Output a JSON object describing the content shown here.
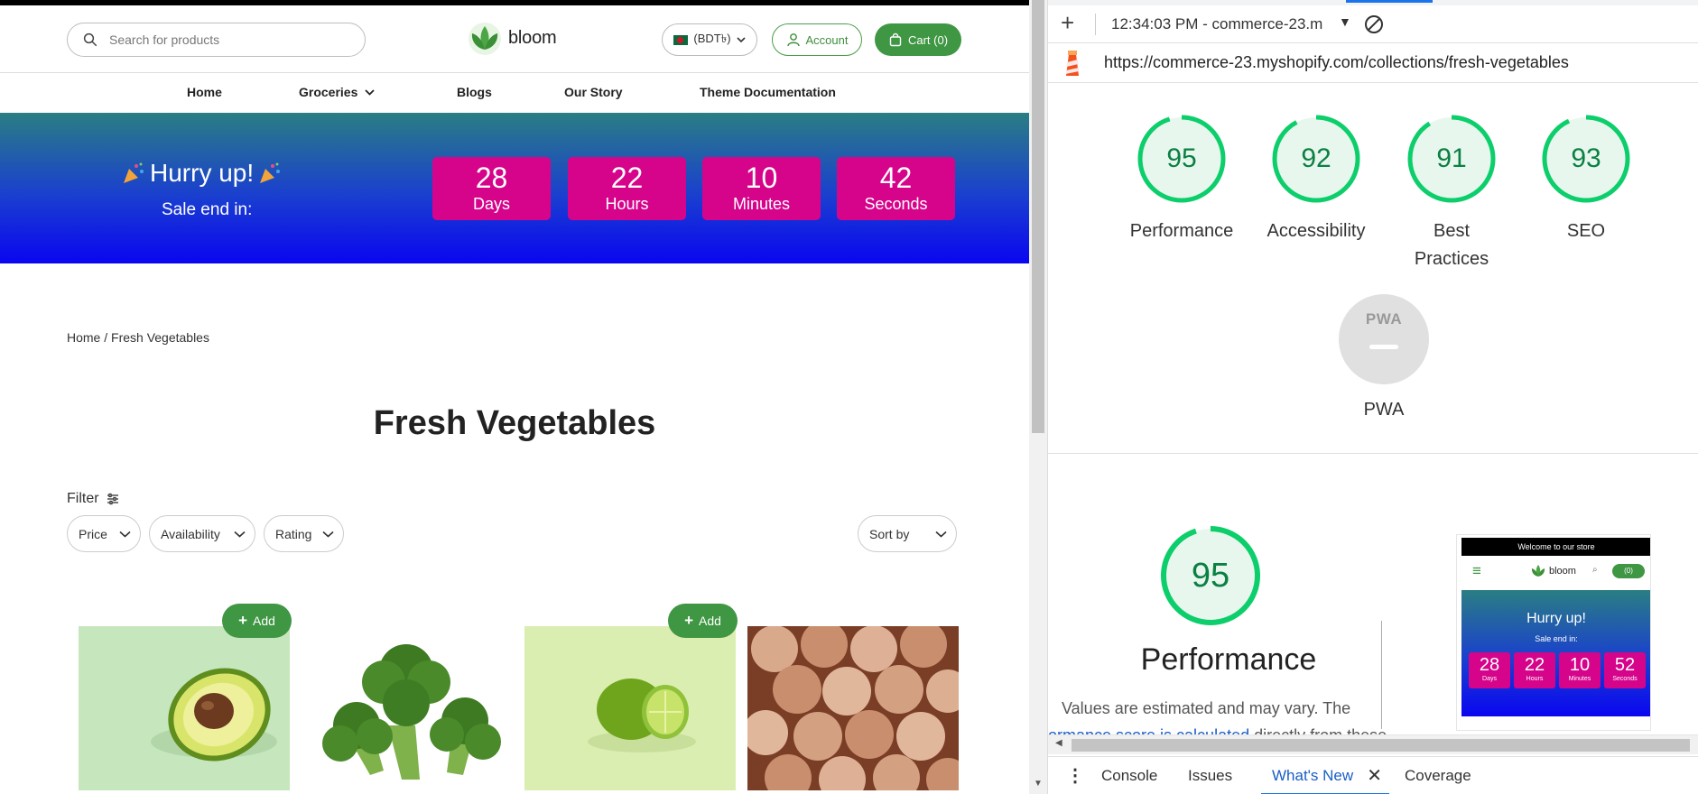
{
  "store": {
    "search": {
      "placeholder": "Search for products"
    },
    "logo": {
      "text": "bloom"
    },
    "currency": {
      "label": "(BDT৳)"
    },
    "account": {
      "label": "Account"
    },
    "cart": {
      "label": "Cart (0)"
    },
    "nav": [
      {
        "label": "Home"
      },
      {
        "label": "Groceries"
      },
      {
        "label": "Blogs"
      },
      {
        "label": "Our Story"
      },
      {
        "label": "Theme Documentation"
      }
    ],
    "banner": {
      "headline": "Hurry up!",
      "subtext": "Sale end in:",
      "countdown": [
        {
          "value": "28",
          "unit": "Days"
        },
        {
          "value": "22",
          "unit": "Hours"
        },
        {
          "value": "10",
          "unit": "Minutes"
        },
        {
          "value": "42",
          "unit": "Seconds"
        }
      ]
    },
    "breadcrumb": "Home / Fresh Vegetables",
    "title": "Fresh Vegetables",
    "filter_label": "Filter",
    "filters": [
      {
        "label": "Price"
      },
      {
        "label": "Availability"
      },
      {
        "label": "Rating"
      }
    ],
    "sort_label": "Sort by",
    "add_label": "Add",
    "products": [
      {
        "name": "avocado"
      },
      {
        "name": "broccoli"
      },
      {
        "name": "lime"
      },
      {
        "name": "onion"
      }
    ]
  },
  "devtools": {
    "report_select": "12:34:03 PM - commerce-23.m",
    "url": "https://commerce-23.myshopify.com/collections/fresh-vegetables",
    "scores": [
      {
        "value": "95",
        "label": "Performance"
      },
      {
        "value": "92",
        "label": "Accessibility"
      },
      {
        "value": "91",
        "label": "Best Practices"
      },
      {
        "value": "93",
        "label": "SEO"
      }
    ],
    "pwa": {
      "badge": "PWA",
      "label": "PWA"
    },
    "performance": {
      "score": "95",
      "title": "Performance",
      "desc": "Values are estimated and may vary. The",
      "link": "formance score is calculated",
      "desc2": " directly from these"
    },
    "thumbnail": {
      "welcome": "Welcome to our store",
      "logo": "bloom",
      "cart": "(0)",
      "headline": "Hurry up!",
      "subtext": "Sale end in:",
      "countdown": [
        {
          "value": "28",
          "unit": "Days"
        },
        {
          "value": "22",
          "unit": "Hours"
        },
        {
          "value": "10",
          "unit": "Minutes"
        },
        {
          "value": "52",
          "unit": "Seconds"
        }
      ]
    },
    "drawer_tabs": [
      {
        "label": "Console"
      },
      {
        "label": "Issues"
      },
      {
        "label": "What's New"
      },
      {
        "label": "Coverage"
      }
    ],
    "colors": {
      "gauge_green": "#0cce6b",
      "gauge_text": "#0b8043",
      "accent_pink": "#d6048b",
      "brand_green": "#3f9643"
    }
  }
}
